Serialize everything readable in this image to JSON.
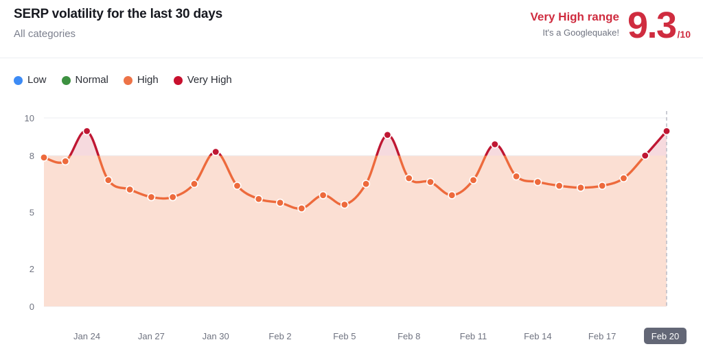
{
  "header": {
    "title": "SERP volatility for the last 30 days",
    "subtitle": "All categories",
    "range_label": "Very High range",
    "range_note": "It's a Googlequake!",
    "score_value": "9.3",
    "score_max": "/10"
  },
  "legend": {
    "items": [
      {
        "label": "Low",
        "color": "#3d8bf5"
      },
      {
        "label": "Normal",
        "color": "#3d9141"
      },
      {
        "label": "High",
        "color": "#ed7347"
      },
      {
        "label": "Very High",
        "color": "#c8102e"
      }
    ]
  },
  "colors": {
    "low_band": "#d9e5f9",
    "normal_band": "#dde9d7",
    "high_band": "#fbdfd3",
    "very_high_band": "#f6dade",
    "line_high": "#ed6a3c",
    "line_very_high": "#bf1733",
    "grid": "#ebecf1",
    "axis_text": "#6f7380",
    "active_tick_bg": "#636776"
  },
  "chart_data": {
    "type": "area",
    "title": "SERP volatility for the last 30 days",
    "subtitle": "All categories",
    "xlabel": "",
    "ylabel": "",
    "ylim": [
      0,
      10
    ],
    "yticks": [
      0,
      2,
      5,
      8,
      10
    ],
    "grid": true,
    "legend_position": "top-left",
    "threshold": 8,
    "bands": [
      {
        "name": "Low",
        "from": 0,
        "to": 2,
        "color": "#d9e5f9"
      },
      {
        "name": "Normal",
        "from": 2,
        "to": 5,
        "color": "#dde9d7"
      },
      {
        "name": "High",
        "from": 5,
        "to": 8,
        "color": "#fbdfd3"
      },
      {
        "name": "Very High",
        "from": 8,
        "to": 10,
        "color": "#f6dade"
      }
    ],
    "xticks": [
      "Jan 24",
      "Jan 27",
      "Jan 30",
      "Feb 2",
      "Feb 5",
      "Feb 8",
      "Feb 11",
      "Feb 14",
      "Feb 17",
      "Feb 20"
    ],
    "active_xtick": "Feb 20",
    "x": [
      "Jan 22",
      "Jan 23",
      "Jan 24",
      "Jan 25",
      "Jan 26",
      "Jan 27",
      "Jan 28",
      "Jan 29",
      "Jan 30",
      "Jan 31",
      "Feb 1",
      "Feb 2",
      "Feb 3",
      "Feb 4",
      "Feb 5",
      "Feb 6",
      "Feb 7",
      "Feb 8",
      "Feb 9",
      "Feb 10",
      "Feb 11",
      "Feb 12",
      "Feb 13",
      "Feb 14",
      "Feb 15",
      "Feb 16",
      "Feb 17",
      "Feb 18",
      "Feb 19",
      "Feb 20"
    ],
    "values": [
      7.9,
      7.7,
      9.3,
      6.7,
      6.2,
      5.8,
      5.8,
      6.5,
      8.2,
      6.4,
      5.7,
      5.5,
      5.2,
      5.9,
      5.4,
      6.5,
      9.1,
      6.8,
      6.6,
      5.9,
      6.7,
      8.6,
      6.9,
      6.6,
      6.4,
      6.3,
      6.4,
      6.8,
      8.0,
      9.3
    ],
    "series_name": "SERP volatility"
  }
}
